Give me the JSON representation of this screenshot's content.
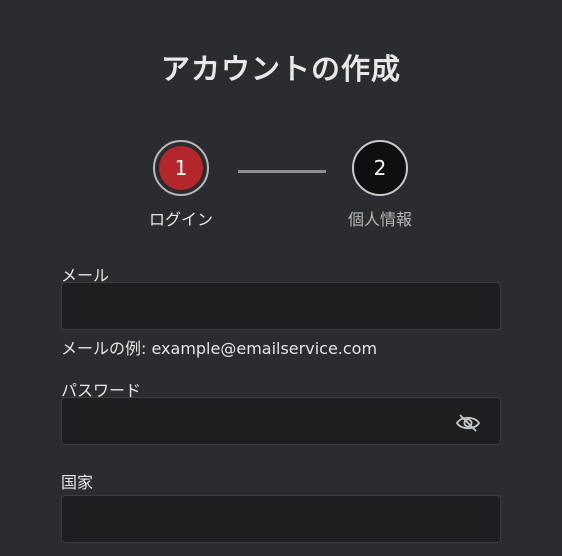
{
  "page": {
    "title": "アカウントの作成"
  },
  "stepper": {
    "steps": [
      {
        "number": "1",
        "label": "ログイン",
        "state": "active"
      },
      {
        "number": "2",
        "label": "個人情報",
        "state": "inactive"
      }
    ]
  },
  "form": {
    "email": {
      "label": "メール",
      "value": "",
      "helper": "メールの例: example@emailservice.com"
    },
    "password": {
      "label": "パスワード",
      "value": "",
      "toggle_icon": "eye-slash-icon"
    },
    "country": {
      "label": "国家",
      "value": ""
    }
  },
  "colors": {
    "background": "#2a2c2f",
    "input_background": "#1c1e20",
    "active_step": "#b3262c",
    "inactive_step": "#0e0f10"
  }
}
